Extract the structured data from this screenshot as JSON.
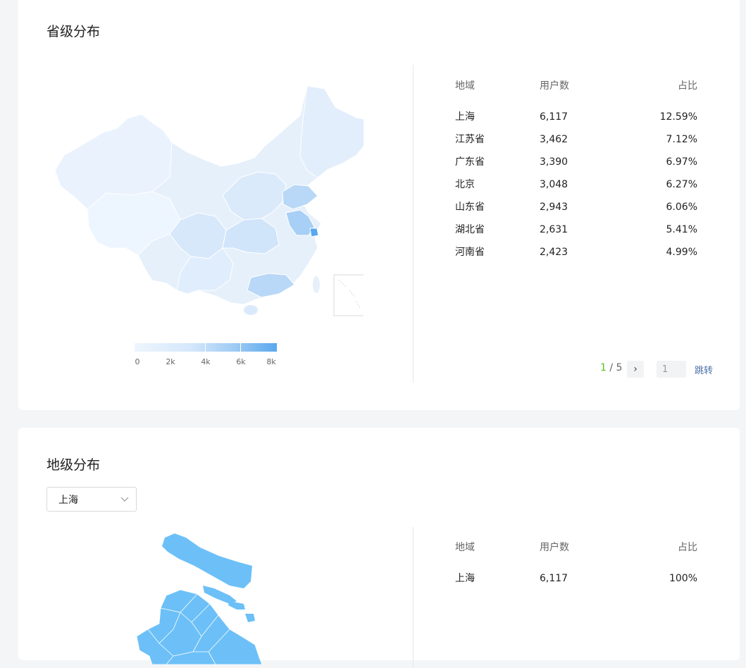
{
  "province_section": {
    "title": "省级分布",
    "legend_labels": [
      "0",
      "2k",
      "4k",
      "6k",
      "8k"
    ],
    "table": {
      "headers": {
        "region": "地域",
        "users": "用户数",
        "share": "占比"
      },
      "rows": [
        {
          "region": "上海",
          "users": "6,117",
          "share": "12.59%"
        },
        {
          "region": "江苏省",
          "users": "3,462",
          "share": "7.12%"
        },
        {
          "region": "广东省",
          "users": "3,390",
          "share": "6.97%"
        },
        {
          "region": "北京",
          "users": "3,048",
          "share": "6.27%"
        },
        {
          "region": "山东省",
          "users": "2,943",
          "share": "6.06%"
        },
        {
          "region": "湖北省",
          "users": "2,631",
          "share": "5.41%"
        },
        {
          "region": "河南省",
          "users": "2,423",
          "share": "4.99%"
        }
      ]
    },
    "pagination": {
      "current": "1",
      "separator": " / ",
      "total": "5",
      "input_value": "1",
      "jump_label": "跳转"
    }
  },
  "city_section": {
    "title": "地级分布",
    "select": {
      "value": "上海"
    },
    "table": {
      "headers": {
        "region": "地域",
        "users": "用户数",
        "share": "占比"
      },
      "rows": [
        {
          "region": "上海",
          "users": "6,117",
          "share": "100%"
        }
      ]
    }
  },
  "colors": {
    "map_low": "#eef5fd",
    "map_high": "#59a7ee",
    "city_fill": "#6cc0f7",
    "page_current": "#52c41a"
  }
}
